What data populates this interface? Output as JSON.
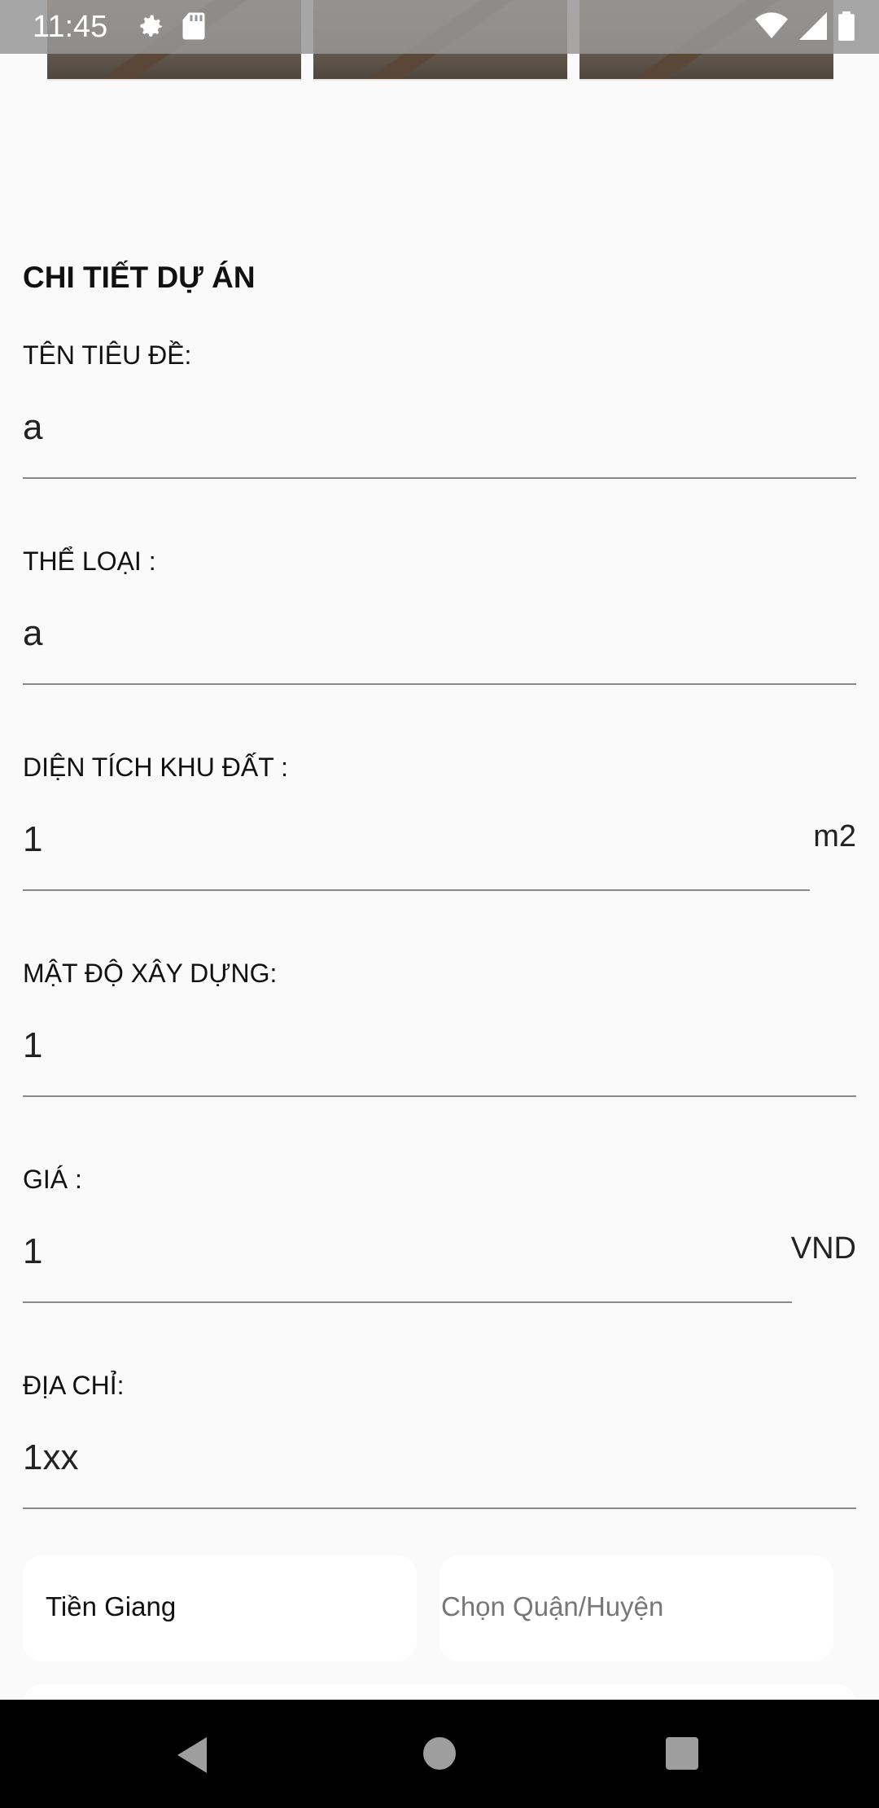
{
  "status_bar": {
    "time": "11:45",
    "left_icons": [
      "gear-icon",
      "sd-card-icon"
    ],
    "right_icons": [
      "wifi-icon",
      "signal-icon",
      "battery-icon"
    ]
  },
  "gallery": {
    "thumbnails": [
      "thumbnail-1",
      "thumbnail-2",
      "thumbnail-3"
    ]
  },
  "form": {
    "section_title": "CHI TIẾT DỰ ÁN",
    "fields": [
      {
        "label": "TÊN TIÊU ĐỀ:",
        "value": "a",
        "unit": ""
      },
      {
        "label": "THỂ LOẠI :",
        "value": "a",
        "unit": ""
      },
      {
        "label": "DIỆN TÍCH KHU ĐẤT :",
        "value": "1",
        "unit": "m2"
      },
      {
        "label": "MẬT ĐỘ XÂY DỰNG:",
        "value": "1",
        "unit": ""
      },
      {
        "label": "GIÁ :",
        "value": "1",
        "unit": "VND"
      },
      {
        "label": "ĐỊA CHỈ:",
        "value": "1xx",
        "unit": ""
      }
    ],
    "province_select": {
      "value": "Tiền Giang"
    },
    "district_select": {
      "placeholder": "Chọn Quận/Huyện"
    }
  },
  "nav_bar": {
    "buttons": [
      "back-icon",
      "home-icon",
      "recents-icon"
    ]
  }
}
